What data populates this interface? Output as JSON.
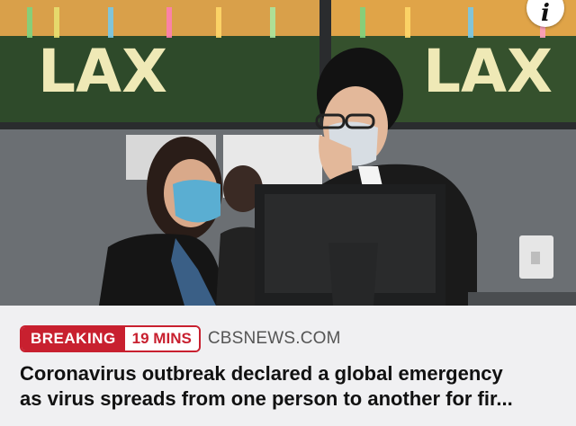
{
  "photo": {
    "sign_text_left": "LAX",
    "sign_text_right": "LAX",
    "alt": ""
  },
  "info_button": {
    "label": "i",
    "icon": "info-icon"
  },
  "badge": {
    "breaking": "BREAKING",
    "age": "19 MINS"
  },
  "source": "CBSNEWS.COM",
  "headline_line1": "Coronavirus outbreak declared a global emergency",
  "headline_line2": "as virus spreads from one person to another for fir...",
  "colors": {
    "accent": "#c8202f",
    "caption_bg": "#f0f0f2"
  }
}
